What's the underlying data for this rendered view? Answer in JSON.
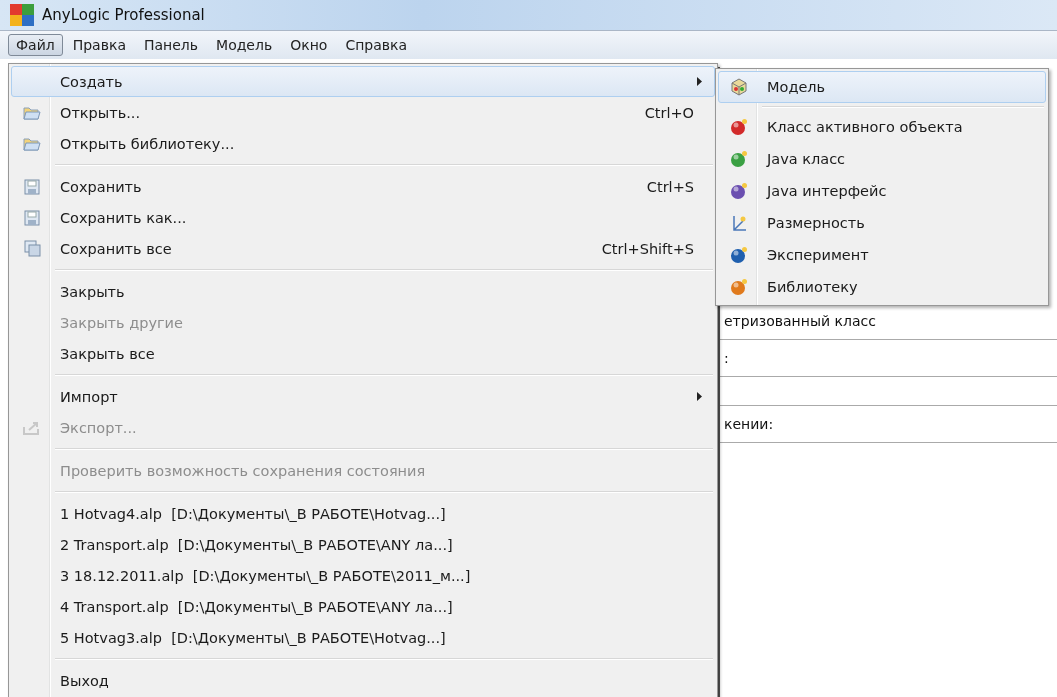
{
  "window": {
    "title": "AnyLogic Professional"
  },
  "menubar": [
    {
      "label": "Файл",
      "selected": true
    },
    {
      "label": "Правка",
      "selected": false
    },
    {
      "label": "Панель",
      "selected": false
    },
    {
      "label": "Модель",
      "selected": false
    },
    {
      "label": "Окно",
      "selected": false
    },
    {
      "label": "Справка",
      "selected": false
    }
  ],
  "background_panel": {
    "texts": [
      "етризованный класс",
      ":",
      "кении:"
    ]
  },
  "file_menu": [
    {
      "kind": "item",
      "label": "Создать",
      "selected": true,
      "disabled": false,
      "submenu": true
    },
    {
      "kind": "item",
      "label": "Открыть...",
      "shortcut": "Ctrl+O",
      "selected": false,
      "disabled": false,
      "submenu": false
    },
    {
      "kind": "item",
      "label": "Открыть библиотеку...",
      "selected": false,
      "disabled": false,
      "submenu": false
    },
    {
      "kind": "separator"
    },
    {
      "kind": "item",
      "label": "Сохранить",
      "shortcut": "Ctrl+S",
      "selected": false,
      "disabled": false,
      "submenu": false
    },
    {
      "kind": "item",
      "label": "Сохранить как...",
      "selected": false,
      "disabled": false,
      "submenu": false
    },
    {
      "kind": "item",
      "label": "Сохранить все",
      "shortcut": "Ctrl+Shift+S",
      "selected": false,
      "disabled": false,
      "submenu": false
    },
    {
      "kind": "separator"
    },
    {
      "kind": "item",
      "label": "Закрыть",
      "selected": false,
      "disabled": false,
      "submenu": false
    },
    {
      "kind": "item",
      "label": "Закрыть другие",
      "selected": false,
      "disabled": true,
      "submenu": false
    },
    {
      "kind": "item",
      "label": "Закрыть все",
      "selected": false,
      "disabled": false,
      "submenu": false
    },
    {
      "kind": "separator"
    },
    {
      "kind": "item",
      "label": "Импорт",
      "selected": false,
      "disabled": false,
      "submenu": true
    },
    {
      "kind": "item",
      "label": "Экспорт...",
      "selected": false,
      "disabled": true,
      "submenu": false
    },
    {
      "kind": "separator"
    },
    {
      "kind": "item",
      "label": "Проверить возможность сохранения состояния",
      "selected": false,
      "disabled": true,
      "submenu": false
    },
    {
      "kind": "separator"
    },
    {
      "kind": "item",
      "label": "1 Hotvag4.alp  [D:\\Документы\\_В РАБОТЕ\\Hotvag...]",
      "selected": false,
      "disabled": false,
      "submenu": false
    },
    {
      "kind": "item",
      "label": "2 Transport.alp  [D:\\Документы\\_В РАБОТЕ\\ANY ла...]",
      "selected": false,
      "disabled": false,
      "submenu": false
    },
    {
      "kind": "item",
      "label": "3 18.12.2011.alp  [D:\\Документы\\_В РАБОТЕ\\2011_м...]",
      "selected": false,
      "disabled": false,
      "submenu": false
    },
    {
      "kind": "item",
      "label": "4 Transport.alp  [D:\\Документы\\_В РАБОТЕ\\ANY ла...]",
      "selected": false,
      "disabled": false,
      "submenu": false
    },
    {
      "kind": "item",
      "label": "5 Hotvag3.alp  [D:\\Документы\\_В РАБОТЕ\\Hotvag...]",
      "selected": false,
      "disabled": false,
      "submenu": false
    },
    {
      "kind": "separator"
    },
    {
      "kind": "item",
      "label": "Выход",
      "selected": false,
      "disabled": false,
      "submenu": false
    }
  ],
  "create_submenu": [
    {
      "kind": "item",
      "label": "Модель",
      "selected": true
    },
    {
      "kind": "separator"
    },
    {
      "kind": "item",
      "label": "Класс активного объекта",
      "selected": false
    },
    {
      "kind": "item",
      "label": "Java класс",
      "selected": false
    },
    {
      "kind": "item",
      "label": "Java интерфейс",
      "selected": false
    },
    {
      "kind": "item",
      "label": "Размерность",
      "selected": false
    },
    {
      "kind": "item",
      "label": "Эксперимент",
      "selected": false
    },
    {
      "kind": "item",
      "label": "Библиотеку",
      "selected": false
    }
  ]
}
